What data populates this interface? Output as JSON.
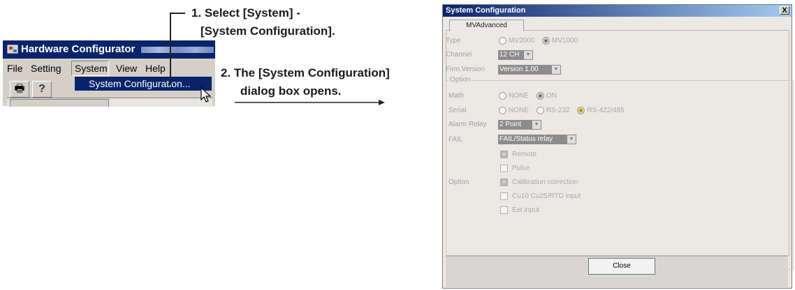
{
  "callout1": {
    "line1": "1. Select [System] -",
    "line2": "[System Configuration]."
  },
  "callout2": {
    "line1": "2. The [System Configuration]",
    "line2": "dialog box opens."
  },
  "app": {
    "title": "Hardware Configurator",
    "menu": [
      "File",
      "Setting",
      "System",
      "View",
      "Help"
    ],
    "dropdown_item": "System Configuration..."
  },
  "dialog": {
    "title": "System Configuration",
    "close_x": "X",
    "tab": "MVAdvanced",
    "type": {
      "label": "Type",
      "options": [
        "MV2000",
        "MV1000"
      ]
    },
    "channel": {
      "label": "Channel",
      "value": "12 CH"
    },
    "firm": {
      "label": "Firm.Version",
      "value": "Version 1.00"
    },
    "option_group": "Option",
    "math": {
      "label": "Math",
      "options": [
        "NONE",
        "ON"
      ]
    },
    "serial": {
      "label": "Serial",
      "options": [
        "NONE",
        "RS-232",
        "RS-422/485"
      ]
    },
    "alarm_relay": {
      "label": "Alarm Relay",
      "value": "2 Point"
    },
    "fail": {
      "label": "FAIL",
      "value": "FAIL/Status relay"
    },
    "checks": [
      "Remote",
      "Pulse",
      "Calibration correction",
      "Cu10 Cu25/RTD input",
      "Ext input"
    ],
    "option_label": "Option",
    "close_button": "Close"
  },
  "colors": {
    "titlebar": "#0a246a",
    "menu_highlight": "#0a246a"
  }
}
